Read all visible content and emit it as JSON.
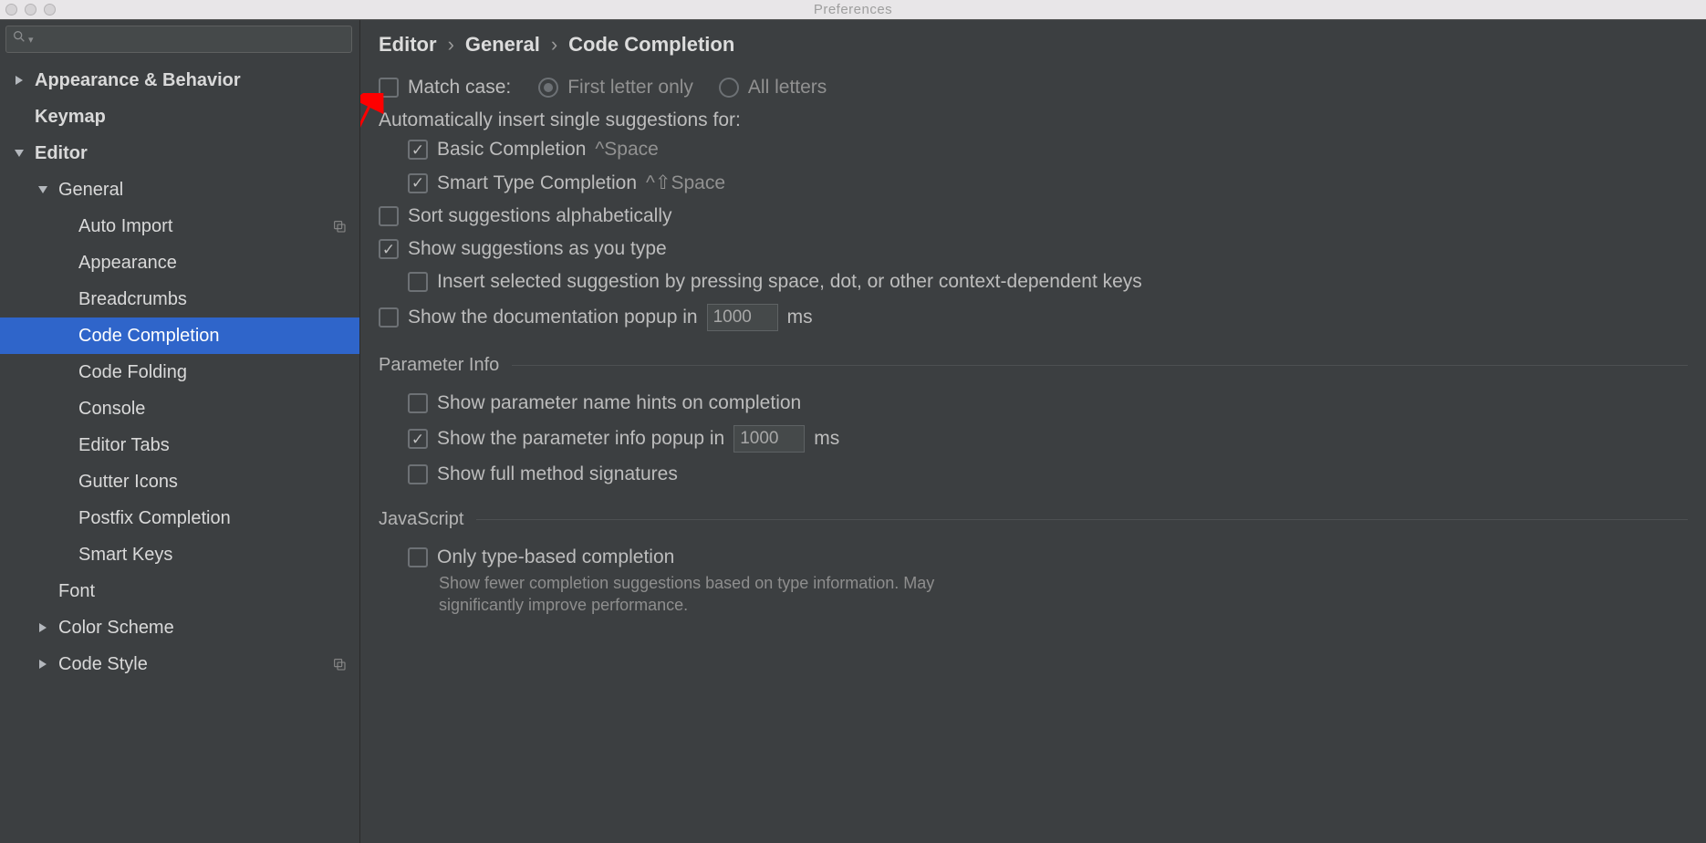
{
  "window_title": "Preferences",
  "search_placeholder": "",
  "sidebar": [
    {
      "id": "appearance-behavior",
      "label": "Appearance & Behavior",
      "indent": 0,
      "bold": true,
      "expandable": true,
      "expanded": false,
      "scope": false
    },
    {
      "id": "keymap",
      "label": "Keymap",
      "indent": 0,
      "bold": true,
      "expandable": false,
      "scope": false
    },
    {
      "id": "editor",
      "label": "Editor",
      "indent": 0,
      "bold": true,
      "expandable": true,
      "expanded": true,
      "scope": false
    },
    {
      "id": "general",
      "label": "General",
      "indent": 1,
      "bold": false,
      "expandable": true,
      "expanded": true,
      "scope": false
    },
    {
      "id": "auto-import",
      "label": "Auto Import",
      "indent": 2,
      "bold": false,
      "expandable": false,
      "scope": true
    },
    {
      "id": "appearance",
      "label": "Appearance",
      "indent": 2,
      "bold": false,
      "expandable": false,
      "scope": false
    },
    {
      "id": "breadcrumbs",
      "label": "Breadcrumbs",
      "indent": 2,
      "bold": false,
      "expandable": false,
      "scope": false
    },
    {
      "id": "code-completion",
      "label": "Code Completion",
      "indent": 2,
      "bold": false,
      "expandable": false,
      "scope": false,
      "selected": true
    },
    {
      "id": "code-folding",
      "label": "Code Folding",
      "indent": 2,
      "bold": false,
      "expandable": false,
      "scope": false
    },
    {
      "id": "console",
      "label": "Console",
      "indent": 2,
      "bold": false,
      "expandable": false,
      "scope": false
    },
    {
      "id": "editor-tabs",
      "label": "Editor Tabs",
      "indent": 2,
      "bold": false,
      "expandable": false,
      "scope": false
    },
    {
      "id": "gutter-icons",
      "label": "Gutter Icons",
      "indent": 2,
      "bold": false,
      "expandable": false,
      "scope": false
    },
    {
      "id": "postfix-completion",
      "label": "Postfix Completion",
      "indent": 2,
      "bold": false,
      "expandable": false,
      "scope": false
    },
    {
      "id": "smart-keys",
      "label": "Smart Keys",
      "indent": 2,
      "bold": false,
      "expandable": false,
      "scope": false
    },
    {
      "id": "font",
      "label": "Font",
      "indent": 1,
      "bold": false,
      "expandable": false,
      "scope": false
    },
    {
      "id": "color-scheme",
      "label": "Color Scheme",
      "indent": 1,
      "bold": false,
      "expandable": true,
      "expanded": false,
      "scope": false
    },
    {
      "id": "code-style",
      "label": "Code Style",
      "indent": 1,
      "bold": false,
      "expandable": true,
      "expanded": false,
      "scope": true
    }
  ],
  "breadcrumb": [
    "Editor",
    "General",
    "Code Completion"
  ],
  "chevron": "›",
  "settings": {
    "match_case_label": "Match case:",
    "match_case_checked": false,
    "match_case_options": [
      {
        "id": "first-letter",
        "label": "First letter only",
        "checked": true
      },
      {
        "id": "all-letters",
        "label": "All letters",
        "checked": false
      }
    ],
    "auto_insert_heading": "Automatically insert single suggestions for:",
    "auto_insert": [
      {
        "id": "basic",
        "label": "Basic Completion",
        "shortcut": "^Space",
        "checked": true
      },
      {
        "id": "smart",
        "label": "Smart Type Completion",
        "shortcut": "^⇧Space",
        "checked": true
      }
    ],
    "sort_alpha_label": "Sort suggestions alphabetically",
    "sort_alpha_checked": false,
    "show_suggest_label": "Show suggestions as you type",
    "show_suggest_checked": true,
    "insert_by_space_label": "Insert selected suggestion by pressing space, dot, or other context-dependent keys",
    "insert_by_space_checked": false,
    "doc_popup_label_pre": "Show the documentation popup in",
    "doc_popup_value": "1000",
    "doc_popup_label_post": "ms",
    "doc_popup_checked": false,
    "param_section": "Parameter Info",
    "param_name_hints_label": "Show parameter name hints on completion",
    "param_name_hints_checked": false,
    "param_popup_pre": "Show the parameter info popup in",
    "param_popup_value": "1000",
    "param_popup_post": "ms",
    "param_popup_checked": true,
    "full_sig_label": "Show full method signatures",
    "full_sig_checked": false,
    "js_section": "JavaScript",
    "type_based_label": "Only type-based completion",
    "type_based_checked": false,
    "type_based_note": "Show fewer completion suggestions based on type information. May significantly improve performance."
  }
}
